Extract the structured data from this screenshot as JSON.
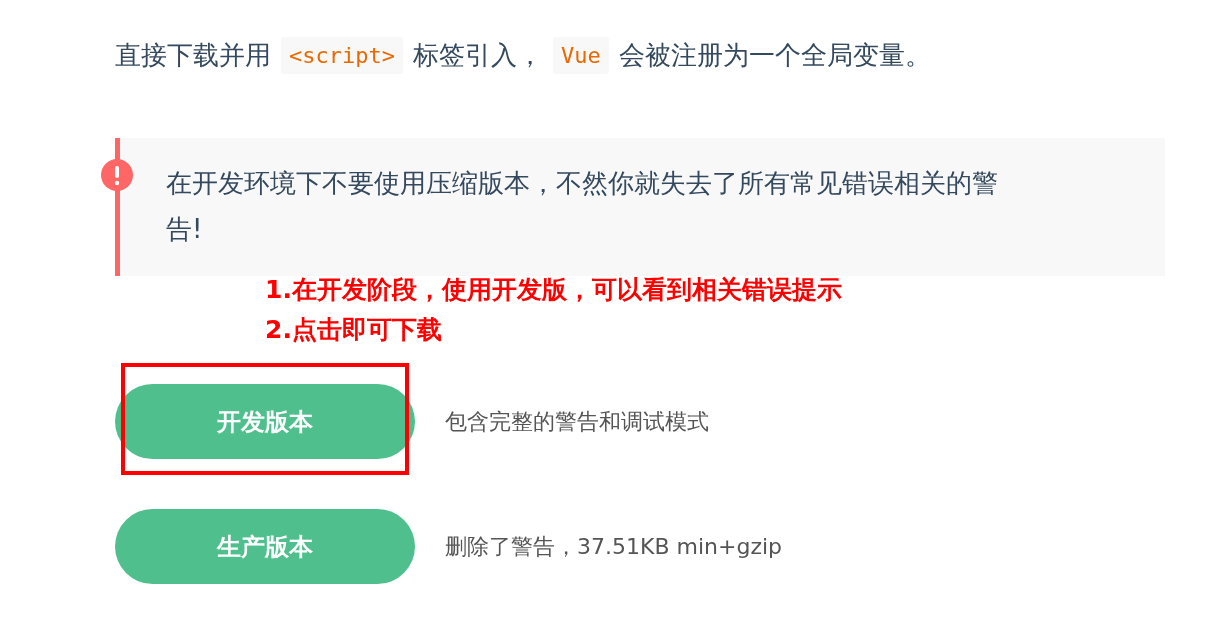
{
  "intro": [
    {
      "kind": "text",
      "text": "直接下载并用"
    },
    {
      "kind": "code",
      "text": "<script>"
    },
    {
      "kind": "text",
      "text": "标签引入，"
    },
    {
      "kind": "code",
      "text": "Vue"
    },
    {
      "kind": "text",
      "text": "会被注册为一个全局变量。"
    }
  ],
  "warning": {
    "text": "在开发环境下不要使用压缩版本，不然你就失去了所有常见错误相关的警告!"
  },
  "annotations": [
    "1.在开发阶段，使用开发版，可以看到相关错误提示",
    "2.点击即可下载"
  ],
  "downloads": [
    {
      "label": "开发版本",
      "description": "包含完整的警告和调试模式",
      "highlighted": true
    },
    {
      "label": "生产版本",
      "description": "删除了警告，37.51KB min+gzip",
      "highlighted": false
    }
  ]
}
